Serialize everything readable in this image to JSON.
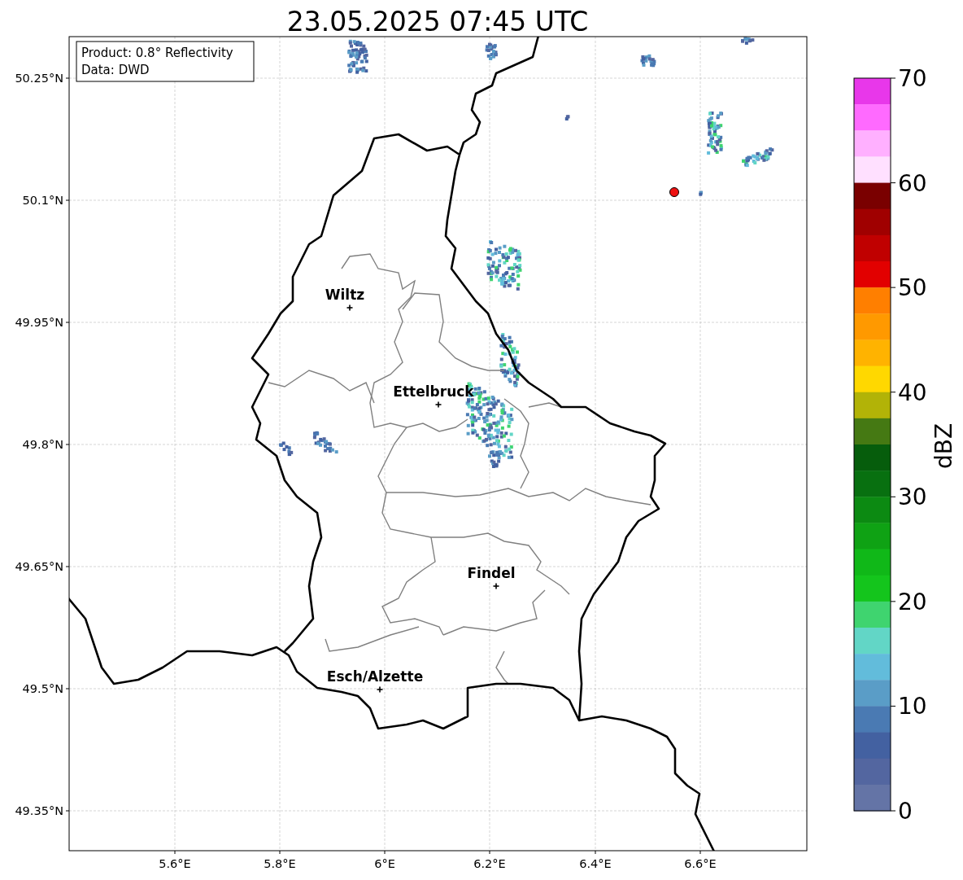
{
  "title": "23.05.2025 07:45 UTC",
  "info_box": [
    "Product: 0.8° Reflectivity",
    "Data: DWD"
  ],
  "map": {
    "xticks": [
      "5.6°E",
      "5.8°E",
      "6°E",
      "6.2°E",
      "6.4°E",
      "6.6°E"
    ],
    "yticks": [
      "50.25°N",
      "50.1°N",
      "49.95°N",
      "49.8°N",
      "49.65°N",
      "49.5°N",
      "49.35°N"
    ],
    "cities": [
      {
        "name": "Wiltz"
      },
      {
        "name": "Ettelbruck"
      },
      {
        "name": "Findel"
      },
      {
        "name": "Esch/Alzette"
      }
    ]
  },
  "colorbar": {
    "label": "dBZ",
    "ticks": [
      "70",
      "60",
      "50",
      "40",
      "30",
      "20",
      "10",
      "0"
    ],
    "bands": [
      {
        "color": "#e837ea"
      },
      {
        "color": "#ff6aff"
      },
      {
        "color": "#ffb0ff"
      },
      {
        "color": "#ffe0ff"
      },
      {
        "color": "#7a0000"
      },
      {
        "color": "#a00000"
      },
      {
        "color": "#c00000"
      },
      {
        "color": "#e20000"
      },
      {
        "color": "#ff7f00"
      },
      {
        "color": "#ff9900"
      },
      {
        "color": "#ffb300"
      },
      {
        "color": "#ffd800"
      },
      {
        "color": "#b2b307"
      },
      {
        "color": "#457913"
      },
      {
        "color": "#065d0c"
      },
      {
        "color": "#087010"
      },
      {
        "color": "#0c8a12"
      },
      {
        "color": "#0fa214"
      },
      {
        "color": "#10b818"
      },
      {
        "color": "#14c51c"
      },
      {
        "color": "#3fd46f"
      },
      {
        "color": "#62d6c6"
      },
      {
        "color": "#62bcdb"
      },
      {
        "color": "#5a9dc7"
      },
      {
        "color": "#4a7ab3"
      },
      {
        "color": "#4361a1"
      },
      {
        "color": "#5366a0"
      },
      {
        "color": "#6474a6"
      }
    ]
  }
}
